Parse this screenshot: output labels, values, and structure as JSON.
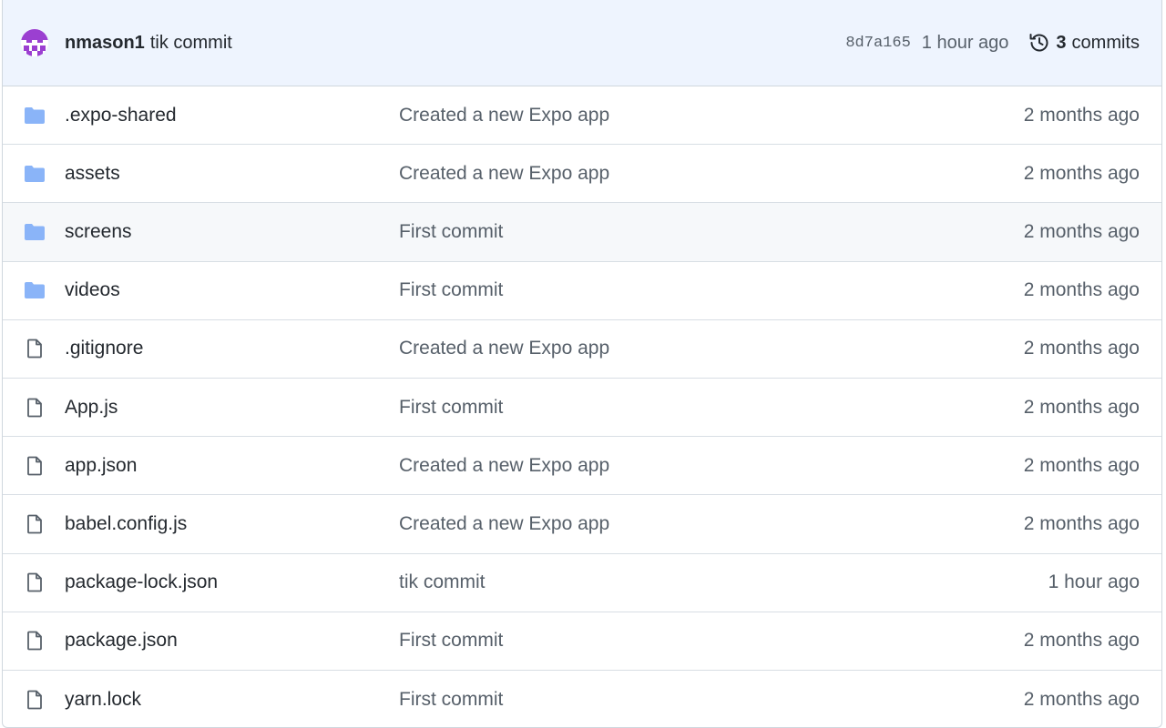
{
  "latest_commit": {
    "author": "nmason1",
    "message": "tik commit",
    "sha": "8d7a165",
    "time": "1 hour ago",
    "commits_count": "3",
    "commits_label": "commits"
  },
  "files": [
    {
      "name": ".expo-shared",
      "type": "folder",
      "message": "Created a new Expo app",
      "age": "2 months ago"
    },
    {
      "name": "assets",
      "type": "folder",
      "message": "Created a new Expo app",
      "age": "2 months ago"
    },
    {
      "name": "screens",
      "type": "folder",
      "message": "First commit",
      "age": "2 months ago"
    },
    {
      "name": "videos",
      "type": "folder",
      "message": "First commit",
      "age": "2 months ago"
    },
    {
      "name": ".gitignore",
      "type": "file",
      "message": "Created a new Expo app",
      "age": "2 months ago"
    },
    {
      "name": "App.js",
      "type": "file",
      "message": "First commit",
      "age": "2 months ago"
    },
    {
      "name": "app.json",
      "type": "file",
      "message": "Created a new Expo app",
      "age": "2 months ago"
    },
    {
      "name": "babel.config.js",
      "type": "file",
      "message": "Created a new Expo app",
      "age": "2 months ago"
    },
    {
      "name": "package-lock.json",
      "type": "file",
      "message": "tik commit",
      "age": "1 hour ago"
    },
    {
      "name": "package.json",
      "type": "file",
      "message": "First commit",
      "age": "2 months ago"
    },
    {
      "name": "yarn.lock",
      "type": "file",
      "message": "First commit",
      "age": "2 months ago"
    }
  ],
  "colors": {
    "folder": "#8ab4f8",
    "header_bg": "#eef4fe",
    "avatar": "#9b3fd1",
    "hover_row": "#f6f8fa"
  }
}
